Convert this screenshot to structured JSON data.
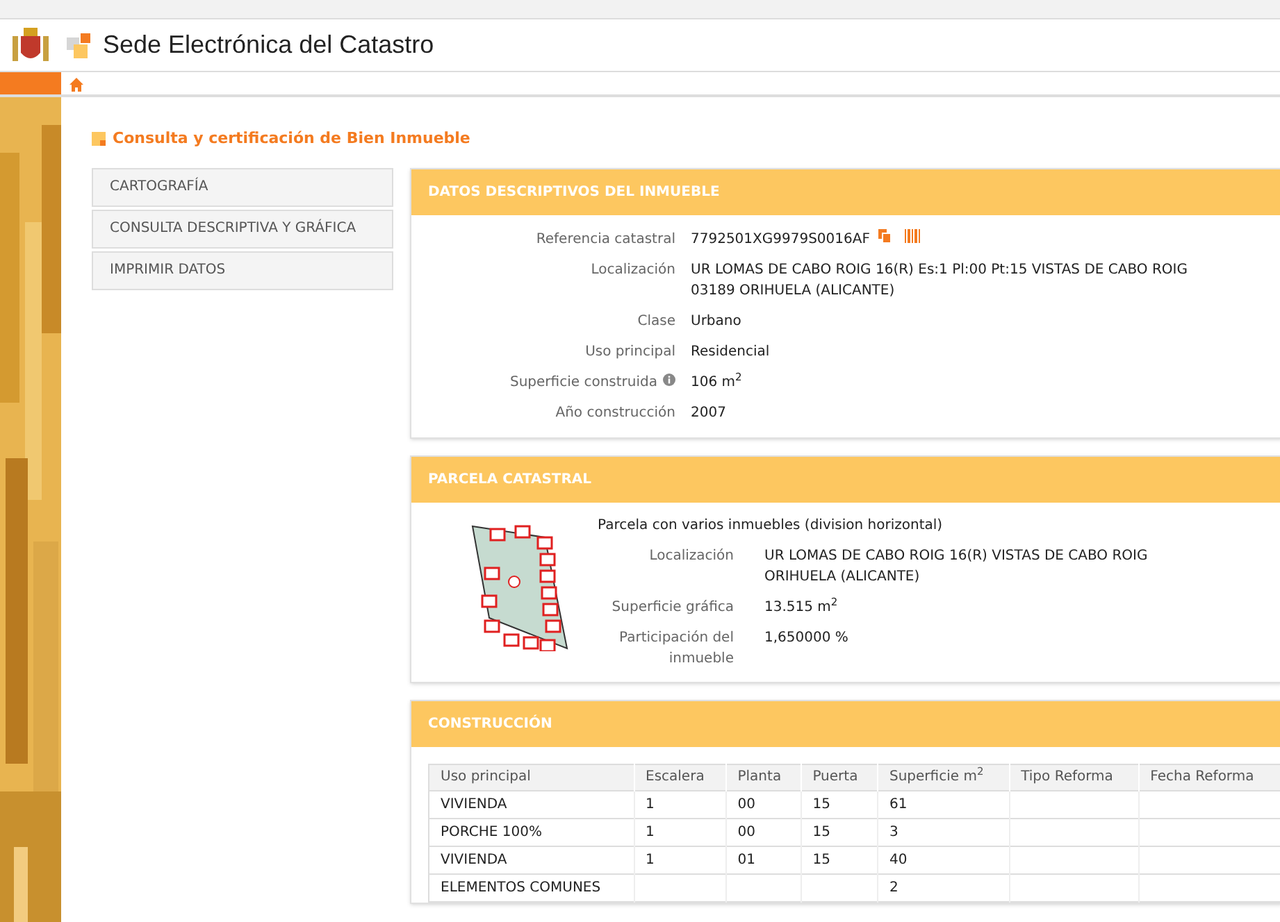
{
  "header": {
    "title": "Sede Electrónica del Catastro"
  },
  "page_title": "Consulta y certificación de Bien Inmueble",
  "sidebar": {
    "items": [
      {
        "label": "CARTOGRAFÍA"
      },
      {
        "label": "CONSULTA DESCRIPTIVA Y GRÁFICA"
      },
      {
        "label": "IMPRIMIR DATOS"
      }
    ]
  },
  "datos": {
    "title": "DATOS DESCRIPTIVOS DEL INMUEBLE",
    "fields": [
      {
        "label": "Referencia catastral",
        "value": "7792501XG9979S0016AF",
        "kind": "reference"
      },
      {
        "label": "Localización",
        "value": "UR LOMAS DE CABO ROIG 16(R) Es:1 Pl:00 Pt:15 VISTAS DE CABO ROIG\n03189 ORIHUELA (ALICANTE)",
        "kind": "text"
      },
      {
        "label": "Clase",
        "value": "Urbano",
        "kind": "text"
      },
      {
        "label": "Uso principal",
        "value": "Residencial",
        "kind": "text"
      },
      {
        "label": "Superficie construida",
        "value": "106 m$^{2}$",
        "kind": "info"
      },
      {
        "label": "Año construcción",
        "value": "2007",
        "kind": "text"
      }
    ]
  },
  "parcela": {
    "title": "PARCELA CATASTRAL",
    "description": "Parcela con varios inmuebles (division horizontal)",
    "fields": [
      {
        "label": "Localización",
        "value": "UR LOMAS DE CABO ROIG 16(R) VISTAS DE CABO ROIG\nORIHUELA (ALICANTE)"
      },
      {
        "label": "Superficie gráfica",
        "value": "13.515 m$^{2}$"
      },
      {
        "label": "Participación del\ninmueble",
        "value": "1,650000 %"
      }
    ]
  },
  "construccion": {
    "title": "CONSTRUCCIÓN",
    "table": {
      "columns": [
        "Uso principal",
        "Escalera",
        "Planta",
        "Puerta",
        "Superficie m$^{2}$",
        "Tipo Reforma",
        "Fecha Reforma"
      ],
      "rows": [
        [
          "VIVIENDA",
          "1",
          "00",
          "15",
          "61",
          "",
          ""
        ],
        [
          "PORCHE 100%",
          "1",
          "00",
          "15",
          "3",
          "",
          ""
        ],
        [
          "VIVIENDA",
          "1",
          "01",
          "15",
          "40",
          "",
          ""
        ],
        [
          "ELEMENTOS COMUNES",
          "",
          "",
          "",
          "2",
          "",
          ""
        ]
      ]
    }
  }
}
